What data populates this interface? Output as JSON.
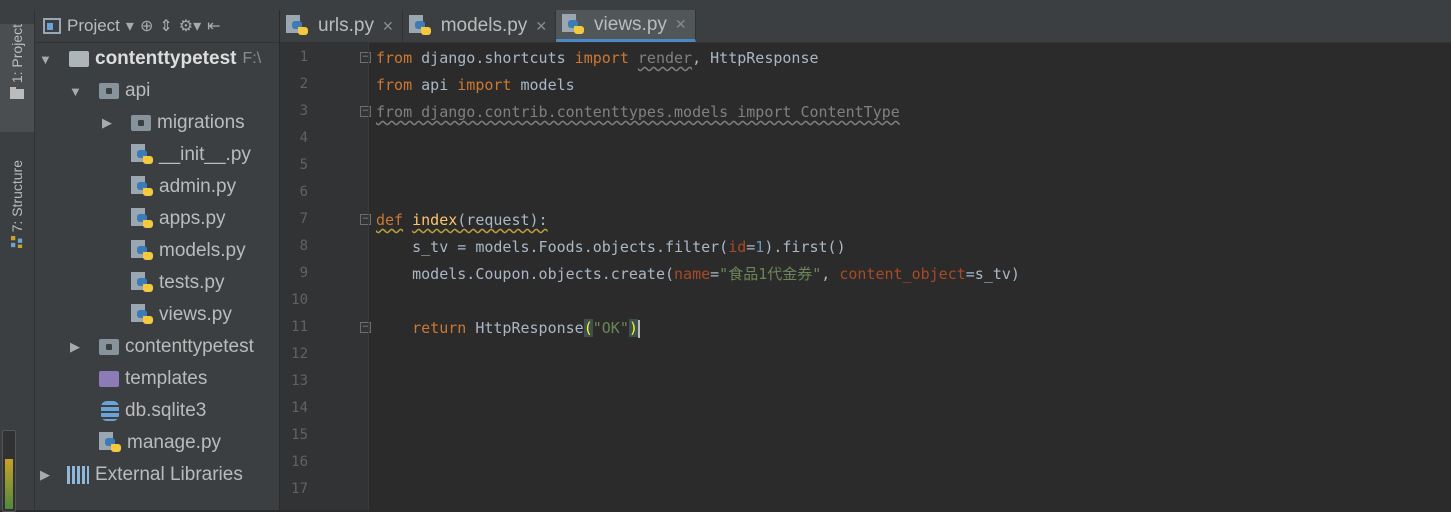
{
  "tool_window_strip": {
    "project_tab": "1: Project",
    "structure_tab": "7: Structure"
  },
  "project_panel": {
    "title": "Project",
    "tree": [
      {
        "label": "contenttypetest",
        "hint": "F:\\",
        "kind": "root-folder",
        "arrow": "▼"
      },
      {
        "label": "api",
        "kind": "package",
        "arrow": "▼"
      },
      {
        "label": "migrations",
        "kind": "package",
        "arrow": "▶"
      },
      {
        "label": "__init__.py",
        "kind": "python-file"
      },
      {
        "label": "admin.py",
        "kind": "python-file"
      },
      {
        "label": "apps.py",
        "kind": "python-file"
      },
      {
        "label": "models.py",
        "kind": "python-file"
      },
      {
        "label": "tests.py",
        "kind": "python-file"
      },
      {
        "label": "views.py",
        "kind": "python-file"
      },
      {
        "label": "contenttypetest",
        "kind": "package",
        "arrow": "▶"
      },
      {
        "label": "templates",
        "kind": "templates-folder"
      },
      {
        "label": "db.sqlite3",
        "kind": "database-file"
      },
      {
        "label": "manage.py",
        "kind": "python-file"
      },
      {
        "label": "External Libraries",
        "kind": "libraries",
        "arrow": "▶"
      }
    ]
  },
  "editor_tabs": [
    {
      "label": "urls.py",
      "active": false
    },
    {
      "label": "models.py",
      "active": false
    },
    {
      "label": "views.py",
      "active": true
    }
  ],
  "editor": {
    "line_numbers": [
      "1",
      "2",
      "3",
      "4",
      "5",
      "6",
      "7",
      "8",
      "9",
      "10",
      "11",
      "12",
      "13",
      "14",
      "15",
      "16",
      "17"
    ],
    "code": {
      "l1": [
        "from",
        " django.shortcuts ",
        "import",
        " ",
        "render",
        ", HttpResponse"
      ],
      "l2": [
        "from",
        " api ",
        "import",
        " models"
      ],
      "l3": "from django.contrib.contenttypes.models import ContentType",
      "l7": [
        "def",
        " ",
        "index",
        "(request):"
      ],
      "l8": [
        "    s_tv = models.Foods.objects.filter(",
        "id",
        "=",
        "1",
        ").first()"
      ],
      "l9": [
        "    models.Coupon.objects.create(",
        "name",
        "=",
        "\"食品1代金券\"",
        ", ",
        "content_object",
        "=s_tv)"
      ],
      "l11": [
        "    ",
        "return",
        " HttpResponse",
        "(",
        "\"OK\"",
        ")"
      ]
    }
  },
  "colors": {
    "keyword": "#cc7832",
    "function": "#ffc66d",
    "string": "#6a8759",
    "param": "#aa4926",
    "number": "#6897bb",
    "text": "#a9b7c6",
    "active_tab_underline": "#4a88c7",
    "selected_row": "#0d293e"
  }
}
